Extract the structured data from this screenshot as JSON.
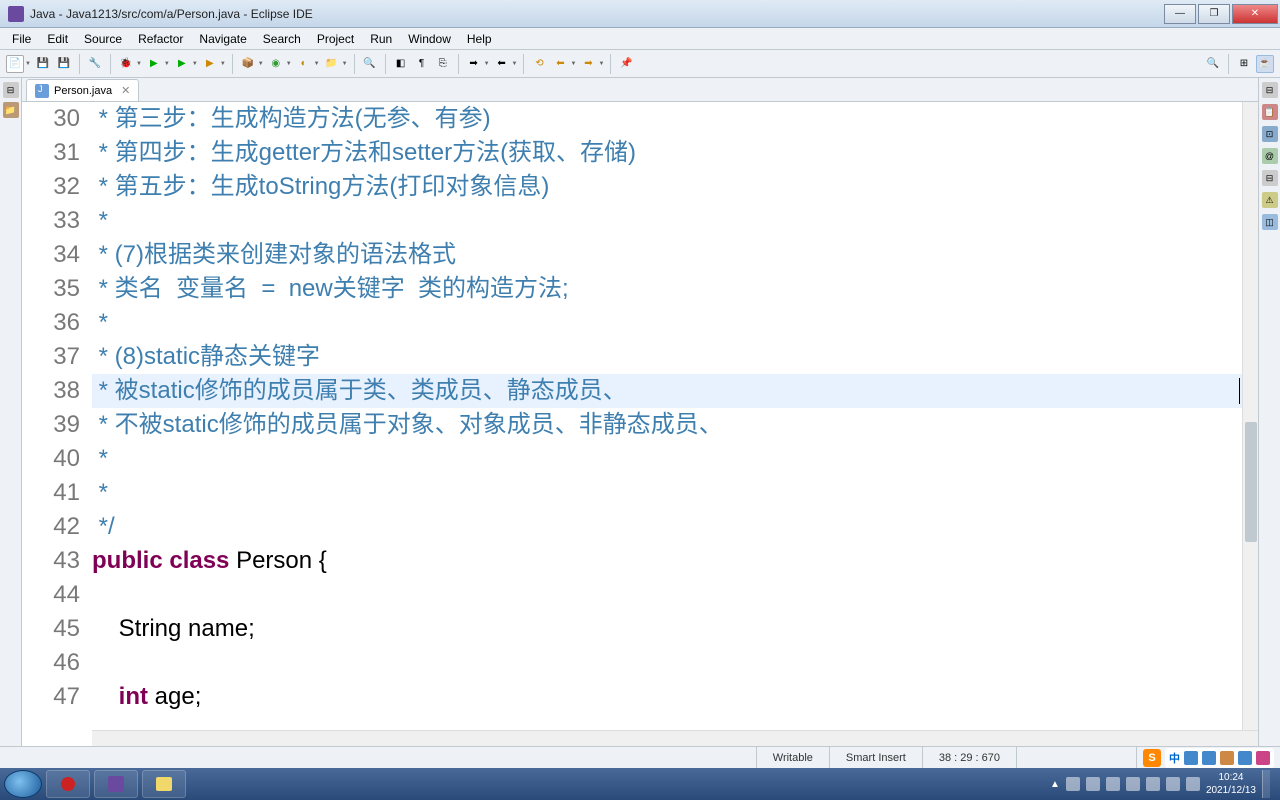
{
  "title": "Java - Java1213/src/com/a/Person.java - Eclipse IDE",
  "menu": [
    "File",
    "Edit",
    "Source",
    "Refactor",
    "Navigate",
    "Search",
    "Project",
    "Run",
    "Window",
    "Help"
  ],
  "tab": {
    "label": "Person.java"
  },
  "code_lines": [
    {
      "n": 30,
      "cls": "comment",
      "t": " * 第三步：生成构造方法(无参、有参)"
    },
    {
      "n": 31,
      "cls": "comment",
      "t": " * 第四步：生成getter方法和setter方法(获取、存储)"
    },
    {
      "n": 32,
      "cls": "comment",
      "t": " * 第五步：生成toString方法(打印对象信息)"
    },
    {
      "n": 33,
      "cls": "comment",
      "t": " * "
    },
    {
      "n": 34,
      "cls": "comment",
      "t": " * (7)根据类来创建对象的语法格式"
    },
    {
      "n": 35,
      "cls": "comment",
      "t": " * 类名  变量名  =  new关键字  类的构造方法;"
    },
    {
      "n": 36,
      "cls": "comment",
      "t": " * "
    },
    {
      "n": 37,
      "cls": "comment",
      "t": " * (8)static静态关键字"
    },
    {
      "n": 38,
      "cls": "comment highlight cursor-line",
      "t": " * 被static修饰的成员属于类、类成员、静态成员、"
    },
    {
      "n": 39,
      "cls": "comment",
      "t": " * 不被static修饰的成员属于对象、对象成员、非静态成员、"
    },
    {
      "n": 40,
      "cls": "comment",
      "t": " * "
    },
    {
      "n": 41,
      "cls": "comment",
      "t": " * "
    },
    {
      "n": 42,
      "cls": "comment",
      "t": " */"
    },
    {
      "n": 43,
      "cls": "",
      "html": "<span class='kw'>public</span> <span class='kw'>class</span> Person {"
    },
    {
      "n": 44,
      "cls": "",
      "t": ""
    },
    {
      "n": 45,
      "cls": "",
      "t": "    String name;"
    },
    {
      "n": 46,
      "cls": "",
      "t": ""
    },
    {
      "n": 47,
      "cls": "",
      "html": "    <span class='kw'>int</span> age;"
    }
  ],
  "status": {
    "writable": "Writable",
    "insert": "Smart Insert",
    "pos": "38 : 29 : 670"
  },
  "ime": {
    "logo": "S",
    "label": "中"
  },
  "clock": {
    "time": "10:24",
    "date": "2021/12/13"
  }
}
